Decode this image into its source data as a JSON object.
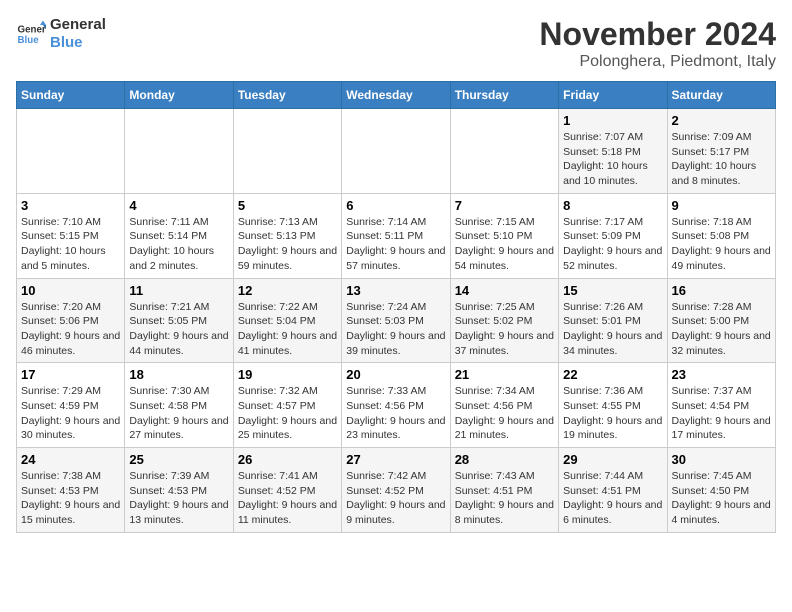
{
  "logo": {
    "line1": "General",
    "line2": "Blue"
  },
  "title": "November 2024",
  "location": "Polonghera, Piedmont, Italy",
  "days_of_week": [
    "Sunday",
    "Monday",
    "Tuesday",
    "Wednesday",
    "Thursday",
    "Friday",
    "Saturday"
  ],
  "weeks": [
    [
      {
        "day": "",
        "info": ""
      },
      {
        "day": "",
        "info": ""
      },
      {
        "day": "",
        "info": ""
      },
      {
        "day": "",
        "info": ""
      },
      {
        "day": "",
        "info": ""
      },
      {
        "day": "1",
        "info": "Sunrise: 7:07 AM\nSunset: 5:18 PM\nDaylight: 10 hours and 10 minutes."
      },
      {
        "day": "2",
        "info": "Sunrise: 7:09 AM\nSunset: 5:17 PM\nDaylight: 10 hours and 8 minutes."
      }
    ],
    [
      {
        "day": "3",
        "info": "Sunrise: 7:10 AM\nSunset: 5:15 PM\nDaylight: 10 hours and 5 minutes."
      },
      {
        "day": "4",
        "info": "Sunrise: 7:11 AM\nSunset: 5:14 PM\nDaylight: 10 hours and 2 minutes."
      },
      {
        "day": "5",
        "info": "Sunrise: 7:13 AM\nSunset: 5:13 PM\nDaylight: 9 hours and 59 minutes."
      },
      {
        "day": "6",
        "info": "Sunrise: 7:14 AM\nSunset: 5:11 PM\nDaylight: 9 hours and 57 minutes."
      },
      {
        "day": "7",
        "info": "Sunrise: 7:15 AM\nSunset: 5:10 PM\nDaylight: 9 hours and 54 minutes."
      },
      {
        "day": "8",
        "info": "Sunrise: 7:17 AM\nSunset: 5:09 PM\nDaylight: 9 hours and 52 minutes."
      },
      {
        "day": "9",
        "info": "Sunrise: 7:18 AM\nSunset: 5:08 PM\nDaylight: 9 hours and 49 minutes."
      }
    ],
    [
      {
        "day": "10",
        "info": "Sunrise: 7:20 AM\nSunset: 5:06 PM\nDaylight: 9 hours and 46 minutes."
      },
      {
        "day": "11",
        "info": "Sunrise: 7:21 AM\nSunset: 5:05 PM\nDaylight: 9 hours and 44 minutes."
      },
      {
        "day": "12",
        "info": "Sunrise: 7:22 AM\nSunset: 5:04 PM\nDaylight: 9 hours and 41 minutes."
      },
      {
        "day": "13",
        "info": "Sunrise: 7:24 AM\nSunset: 5:03 PM\nDaylight: 9 hours and 39 minutes."
      },
      {
        "day": "14",
        "info": "Sunrise: 7:25 AM\nSunset: 5:02 PM\nDaylight: 9 hours and 37 minutes."
      },
      {
        "day": "15",
        "info": "Sunrise: 7:26 AM\nSunset: 5:01 PM\nDaylight: 9 hours and 34 minutes."
      },
      {
        "day": "16",
        "info": "Sunrise: 7:28 AM\nSunset: 5:00 PM\nDaylight: 9 hours and 32 minutes."
      }
    ],
    [
      {
        "day": "17",
        "info": "Sunrise: 7:29 AM\nSunset: 4:59 PM\nDaylight: 9 hours and 30 minutes."
      },
      {
        "day": "18",
        "info": "Sunrise: 7:30 AM\nSunset: 4:58 PM\nDaylight: 9 hours and 27 minutes."
      },
      {
        "day": "19",
        "info": "Sunrise: 7:32 AM\nSunset: 4:57 PM\nDaylight: 9 hours and 25 minutes."
      },
      {
        "day": "20",
        "info": "Sunrise: 7:33 AM\nSunset: 4:56 PM\nDaylight: 9 hours and 23 minutes."
      },
      {
        "day": "21",
        "info": "Sunrise: 7:34 AM\nSunset: 4:56 PM\nDaylight: 9 hours and 21 minutes."
      },
      {
        "day": "22",
        "info": "Sunrise: 7:36 AM\nSunset: 4:55 PM\nDaylight: 9 hours and 19 minutes."
      },
      {
        "day": "23",
        "info": "Sunrise: 7:37 AM\nSunset: 4:54 PM\nDaylight: 9 hours and 17 minutes."
      }
    ],
    [
      {
        "day": "24",
        "info": "Sunrise: 7:38 AM\nSunset: 4:53 PM\nDaylight: 9 hours and 15 minutes."
      },
      {
        "day": "25",
        "info": "Sunrise: 7:39 AM\nSunset: 4:53 PM\nDaylight: 9 hours and 13 minutes."
      },
      {
        "day": "26",
        "info": "Sunrise: 7:41 AM\nSunset: 4:52 PM\nDaylight: 9 hours and 11 minutes."
      },
      {
        "day": "27",
        "info": "Sunrise: 7:42 AM\nSunset: 4:52 PM\nDaylight: 9 hours and 9 minutes."
      },
      {
        "day": "28",
        "info": "Sunrise: 7:43 AM\nSunset: 4:51 PM\nDaylight: 9 hours and 8 minutes."
      },
      {
        "day": "29",
        "info": "Sunrise: 7:44 AM\nSunset: 4:51 PM\nDaylight: 9 hours and 6 minutes."
      },
      {
        "day": "30",
        "info": "Sunrise: 7:45 AM\nSunset: 4:50 PM\nDaylight: 9 hours and 4 minutes."
      }
    ]
  ]
}
